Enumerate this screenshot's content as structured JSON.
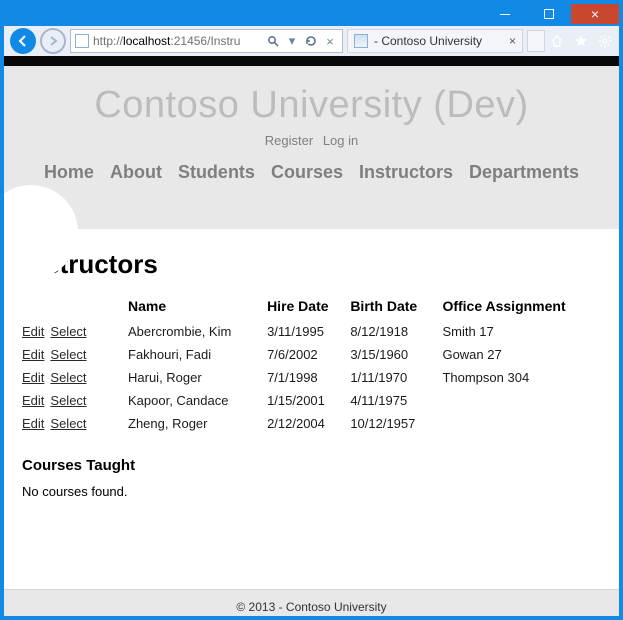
{
  "browser": {
    "url_host": "localhost",
    "url_rest": ":21456/Instru",
    "tab_title": " - Contoso University"
  },
  "site": {
    "title": "Contoso University (Dev)",
    "account": {
      "register": "Register",
      "login": "Log in"
    },
    "nav": {
      "home": "Home",
      "about": "About",
      "students": "Students",
      "courses": "Courses",
      "instructors": "Instructors",
      "departments": "Departments"
    },
    "footer": "© 2013 - Contoso University"
  },
  "page": {
    "heading": "Instructors",
    "columns": {
      "name": "Name",
      "hire": "Hire Date",
      "birth": "Birth Date",
      "office": "Office Assignment"
    },
    "actions": {
      "edit": "Edit",
      "select": "Select"
    },
    "rows": [
      {
        "name": "Abercrombie, Kim",
        "hire": "3/11/1995",
        "birth": "8/12/1918",
        "office": "Smith 17"
      },
      {
        "name": "Fakhouri, Fadi",
        "hire": "7/6/2002",
        "birth": "3/15/1960",
        "office": "Gowan 27"
      },
      {
        "name": "Harui, Roger",
        "hire": "7/1/1998",
        "birth": "1/11/1970",
        "office": "Thompson 304"
      },
      {
        "name": "Kapoor, Candace",
        "hire": "1/15/2001",
        "birth": "4/11/1975",
        "office": ""
      },
      {
        "name": "Zheng, Roger",
        "hire": "2/12/2004",
        "birth": "10/12/1957",
        "office": ""
      }
    ],
    "courses_heading": "Courses Taught",
    "no_courses": "No courses found."
  }
}
